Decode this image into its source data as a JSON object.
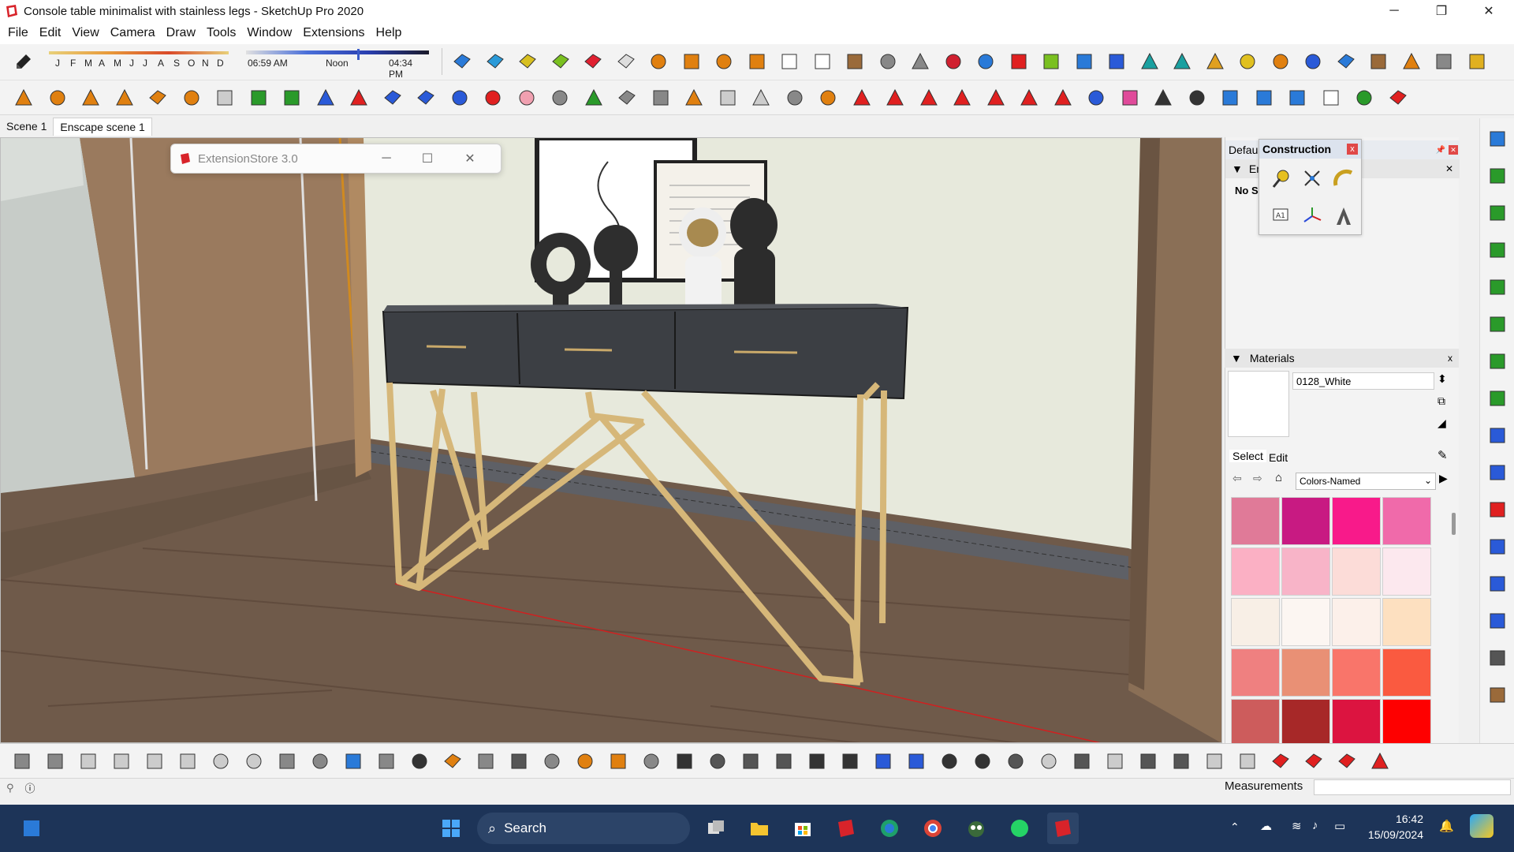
{
  "window": {
    "title": "Console table minimalist with stainless legs - SketchUp Pro 2020",
    "minimize": "─",
    "maximize": "❐",
    "close": "✕"
  },
  "menu": [
    "File",
    "Edit",
    "View",
    "Camera",
    "Draw",
    "Tools",
    "Window",
    "Extensions",
    "Help"
  ],
  "shadows": {
    "months": [
      "J",
      "F",
      "M",
      "A",
      "M",
      "J",
      "J",
      "A",
      "S",
      "O",
      "N",
      "D"
    ],
    "time_start": "06:59 AM",
    "time_mid": "Noon",
    "time_end": "04:34 PM"
  },
  "scenes": [
    "Scene 1",
    "Enscape scene 1"
  ],
  "extension_window": {
    "title": "ExtensionStore 3.0",
    "minimize": "─",
    "maximize": "☐",
    "close": "✕"
  },
  "default_tray": {
    "header": "Defau",
    "entity_section": "En",
    "no_selection": "No S"
  },
  "construction": {
    "title": "Construction",
    "close": "x",
    "tools": [
      "tape-measure-icon",
      "dimension-icon",
      "protractor-icon",
      "text-icon",
      "axes-icon",
      "3d-text-icon"
    ]
  },
  "materials": {
    "header": "Materials",
    "close": "x",
    "current_material": "0128_White",
    "tab_select": "Select",
    "tab_edit": "Edit",
    "library": "Colors-Named",
    "swatches": [
      "#e07a98",
      "#c81a82",
      "#f81a8a",
      "#f06aaa",
      "#fbb0c4",
      "#f8b4c8",
      "#fcdcd8",
      "#fce8ee",
      "#f8efe6",
      "#fcf6f2",
      "#fcf0ea",
      "#fde0c0",
      "#ef8080",
      "#e99075",
      "#f9756a",
      "#fa5a40",
      "#cd5c5c",
      "#a72828",
      "#dc1440",
      "#fe0000"
    ]
  },
  "status": {
    "measurements_label": "Measurements",
    "measurements_value": ""
  },
  "taskbar": {
    "search_placeholder": "Search",
    "time": "16:42",
    "date": "15/09/2024"
  }
}
